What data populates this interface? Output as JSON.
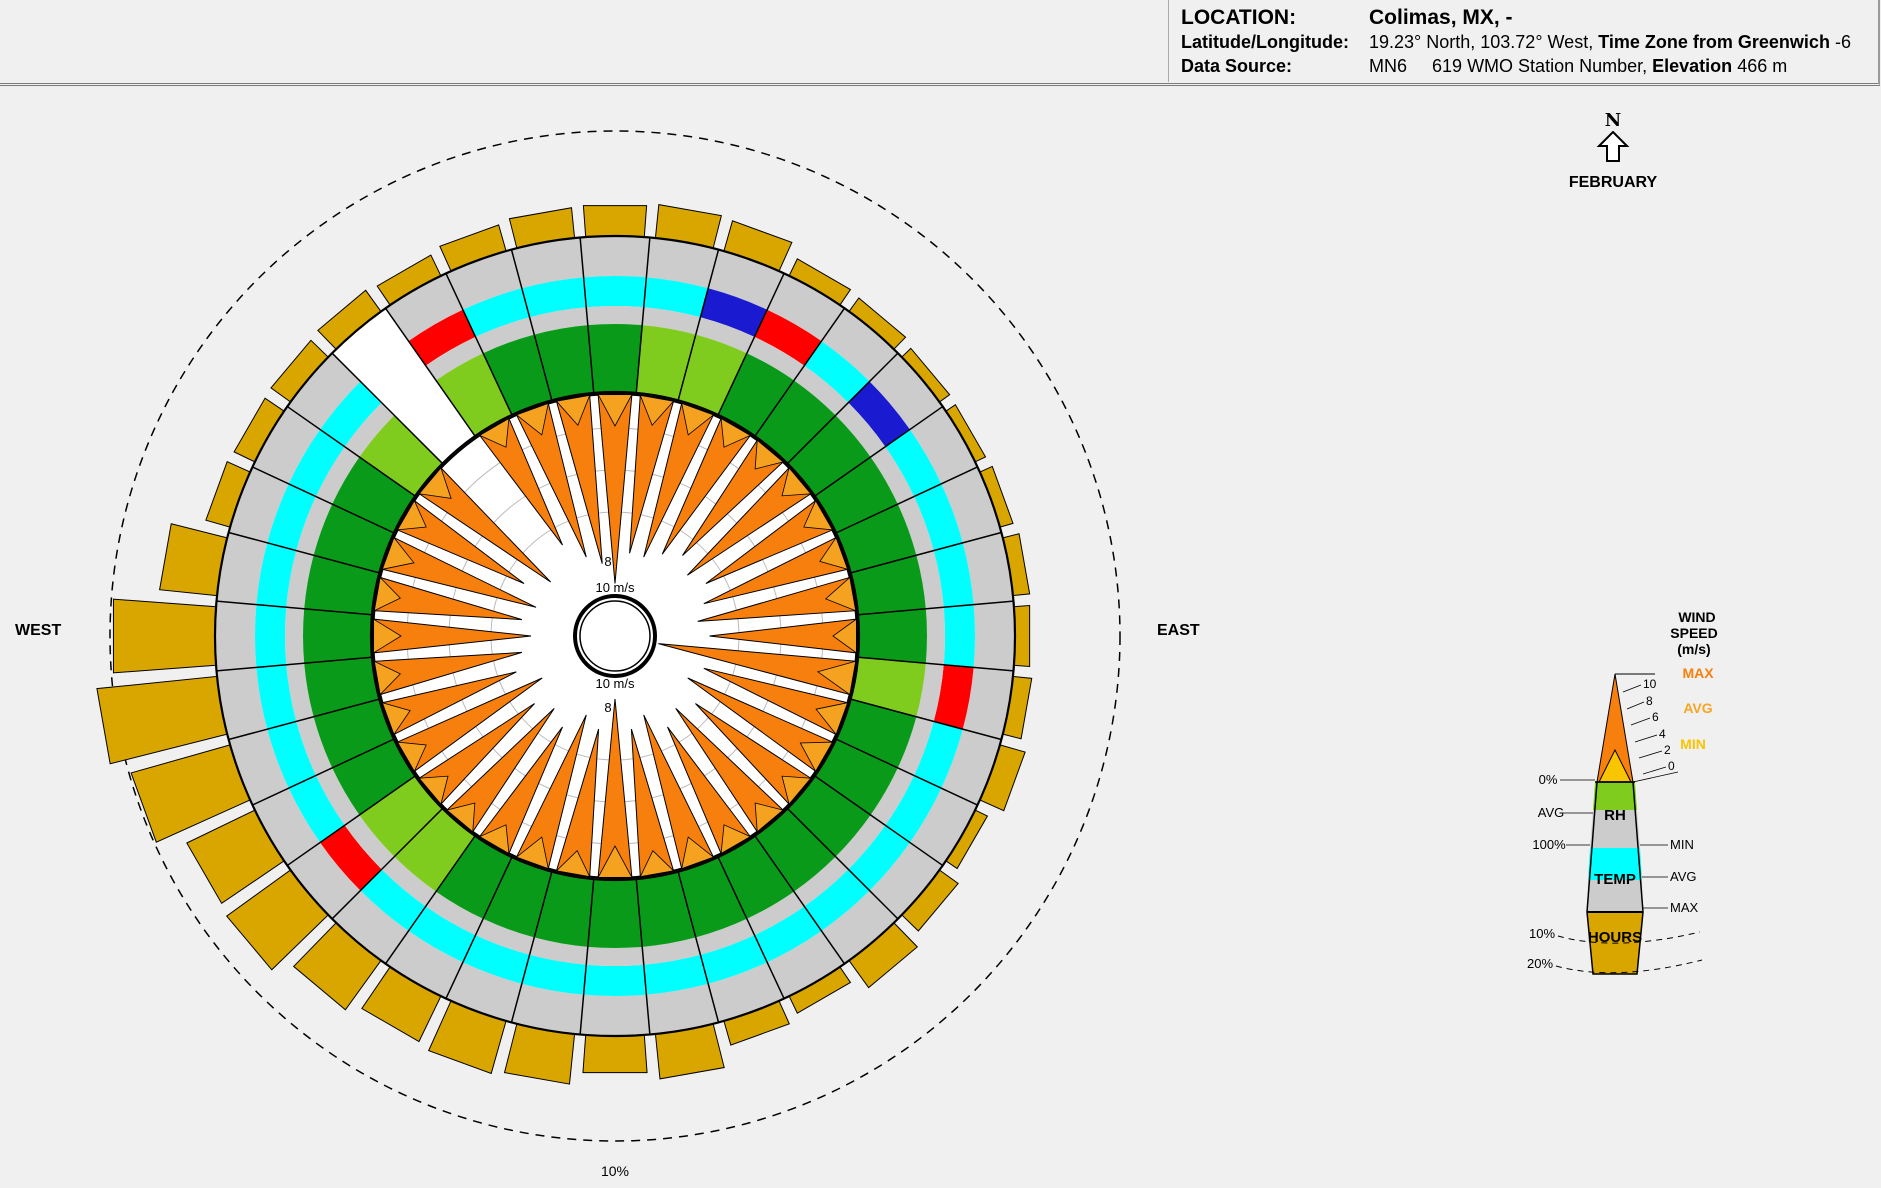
{
  "header": {
    "location_label": "LOCATION:",
    "location_value": "Colimas, MX, -",
    "latlon_label": "Latitude/Longitude:",
    "latlon_text": "19.23° North, 103.72° West,",
    "tz_label": "Time Zone from Greenwich",
    "tz_value": "-6",
    "source_label": "Data Source:",
    "source_code": "MN6",
    "source_station": "619 WMO Station Number,",
    "elev_label": "Elevation",
    "elev_value": "466 m"
  },
  "compass": {
    "north": "N",
    "west": "WEST",
    "east": "EAST",
    "month": "FEBRUARY"
  },
  "legend": {
    "title1": "WIND",
    "title2": "SPEED",
    "title3": "(m/s)",
    "max": "MAX",
    "avg": "AVG",
    "min": "MIN",
    "speed_ticks": [
      "10",
      "8",
      "6",
      "4",
      "2",
      "0"
    ],
    "rh_zero": "0%",
    "rh_avg": "AVG",
    "rh_hundred": "100%",
    "rh": "RH",
    "temp_min": "MIN",
    "temp_avg": "AVG",
    "temp_max": "MAX",
    "temp": "TEMP",
    "hours": "HOURS",
    "hours_10": "10%",
    "hours_20": "20%"
  },
  "colors": {
    "background": "#f0f0f0",
    "max_speed": "#f77f0d",
    "avg_speed": "#f5a623",
    "min_speed": "#f9c400",
    "rh_high": "#0a9a1a",
    "rh_mid": "#7fcc1e",
    "temp": "#00ffff",
    "temp_hot": "#ff0000",
    "temp_cool": "#1a1ad0",
    "hours": "#d9a600",
    "ring_gray": "#cccccc"
  },
  "chart_data": {
    "type": "radial wind wheel",
    "month": "FEBRUARY",
    "directions_deg": [
      0,
      10,
      20,
      30,
      40,
      50,
      60,
      70,
      80,
      90,
      100,
      110,
      120,
      130,
      140,
      150,
      160,
      170,
      180,
      190,
      200,
      210,
      220,
      230,
      240,
      250,
      260,
      270,
      280,
      290,
      300,
      310,
      320,
      330,
      340,
      350
    ],
    "ring_labels": [
      "10 m/s",
      "8",
      "10 m/s",
      "8"
    ],
    "outer_circle_label": "10%",
    "max_speed_mps": [
      9.5,
      8,
      8,
      7.5,
      7,
      7.5,
      7,
      7.5,
      8,
      7.5,
      10,
      7.5,
      8,
      7,
      7.5,
      7,
      8,
      7.5,
      9,
      7.5,
      8,
      7,
      7.5,
      7,
      8,
      7,
      7.5,
      8,
      7.5,
      8,
      7,
      8,
      0,
      7,
      8,
      8.5
    ],
    "avg_speed_mps": [
      4,
      3.5,
      3.5,
      3,
      3,
      3,
      3,
      3,
      3.5,
      3,
      4.5,
      3.5,
      3.5,
      3,
      3,
      3,
      3.5,
      3,
      4,
      3,
      3.5,
      3,
      3,
      3,
      3,
      3,
      3,
      3.5,
      3,
      3.5,
      3,
      3.5,
      0,
      3,
      3.5,
      3.5
    ],
    "rh_level": [
      "high",
      "mid",
      "mid",
      "high",
      "high",
      "high",
      "high",
      "high",
      "high",
      "high",
      "mid",
      "high",
      "high",
      "high",
      "high",
      "high",
      "high",
      "high",
      "high",
      "high",
      "high",
      "high",
      "mid",
      "mid",
      "high",
      "high",
      "high",
      "high",
      "high",
      "high",
      "high",
      "mid",
      "none",
      "mid",
      "high",
      "high"
    ],
    "temp_level": [
      "avg",
      "avg",
      "cool",
      "hot",
      "avg",
      "cool",
      "avg",
      "avg",
      "avg",
      "avg",
      "hot",
      "avg",
      "avg",
      "avg",
      "avg",
      "avg",
      "avg",
      "avg",
      "avg",
      "avg",
      "avg",
      "avg",
      "avg",
      "hot",
      "avg",
      "avg",
      "avg",
      "avg",
      "avg",
      "avg",
      "avg",
      "avg",
      "none",
      "hot",
      "avg",
      "avg"
    ],
    "hours_percent": [
      3,
      3.2,
      3,
      1.8,
      1.6,
      1.2,
      1.1,
      1.3,
      1.6,
      1.5,
      1.8,
      2.5,
      1.3,
      2.2,
      3.2,
      1.8,
      2.4,
      4.3,
      3.6,
      4.8,
      5.2,
      4.8,
      5.8,
      7.5,
      7.2,
      9.8,
      11.5,
      9.8,
      5.5,
      2.4,
      2.2,
      2.3,
      2.5,
      2.2,
      2.6,
      2.9
    ]
  }
}
